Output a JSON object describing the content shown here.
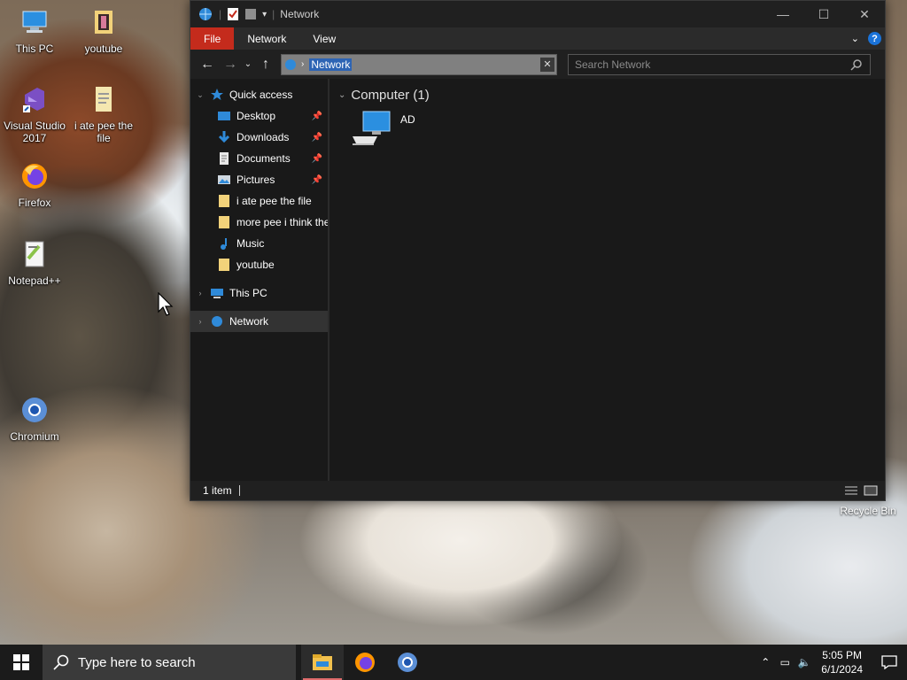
{
  "desktop": {
    "icons": [
      {
        "label": "This PC"
      },
      {
        "label": "youtube"
      },
      {
        "label": "Visual Studio 2017"
      },
      {
        "label": "i ate pee the file"
      },
      {
        "label": "Firefox"
      },
      {
        "label": "Notepad++"
      },
      {
        "label": "Chromium"
      }
    ],
    "recycle_bin": "Recycle Bin"
  },
  "window": {
    "title": "Network",
    "controls": {
      "minimize": "—",
      "maximize": "☐",
      "close": "✕"
    }
  },
  "ribbon": {
    "tabs": [
      {
        "label": "File"
      },
      {
        "label": "Network"
      },
      {
        "label": "View"
      }
    ],
    "help": "?"
  },
  "address": {
    "path": "Network",
    "search_placeholder": "Search Network"
  },
  "nav": {
    "quick_access": "Quick access",
    "items": [
      {
        "label": "Desktop",
        "pinned": true
      },
      {
        "label": "Downloads",
        "pinned": true
      },
      {
        "label": "Documents",
        "pinned": true
      },
      {
        "label": "Pictures",
        "pinned": true
      },
      {
        "label": "i ate pee the file",
        "pinned": false
      },
      {
        "label": "more pee i think the",
        "pinned": false
      },
      {
        "label": "Music",
        "pinned": false
      },
      {
        "label": "youtube",
        "pinned": false
      }
    ],
    "this_pc": "This PC",
    "network": "Network"
  },
  "content": {
    "group": "Computer (1)",
    "items": [
      {
        "label": "AD"
      }
    ]
  },
  "status": {
    "count": "1 item"
  },
  "taskbar": {
    "search_placeholder": "Type here to search",
    "time": "5:05 PM",
    "date": "6/1/2024"
  },
  "colors": {
    "accent_file_tab": "#c42b1c",
    "selection": "#2d64b4"
  }
}
